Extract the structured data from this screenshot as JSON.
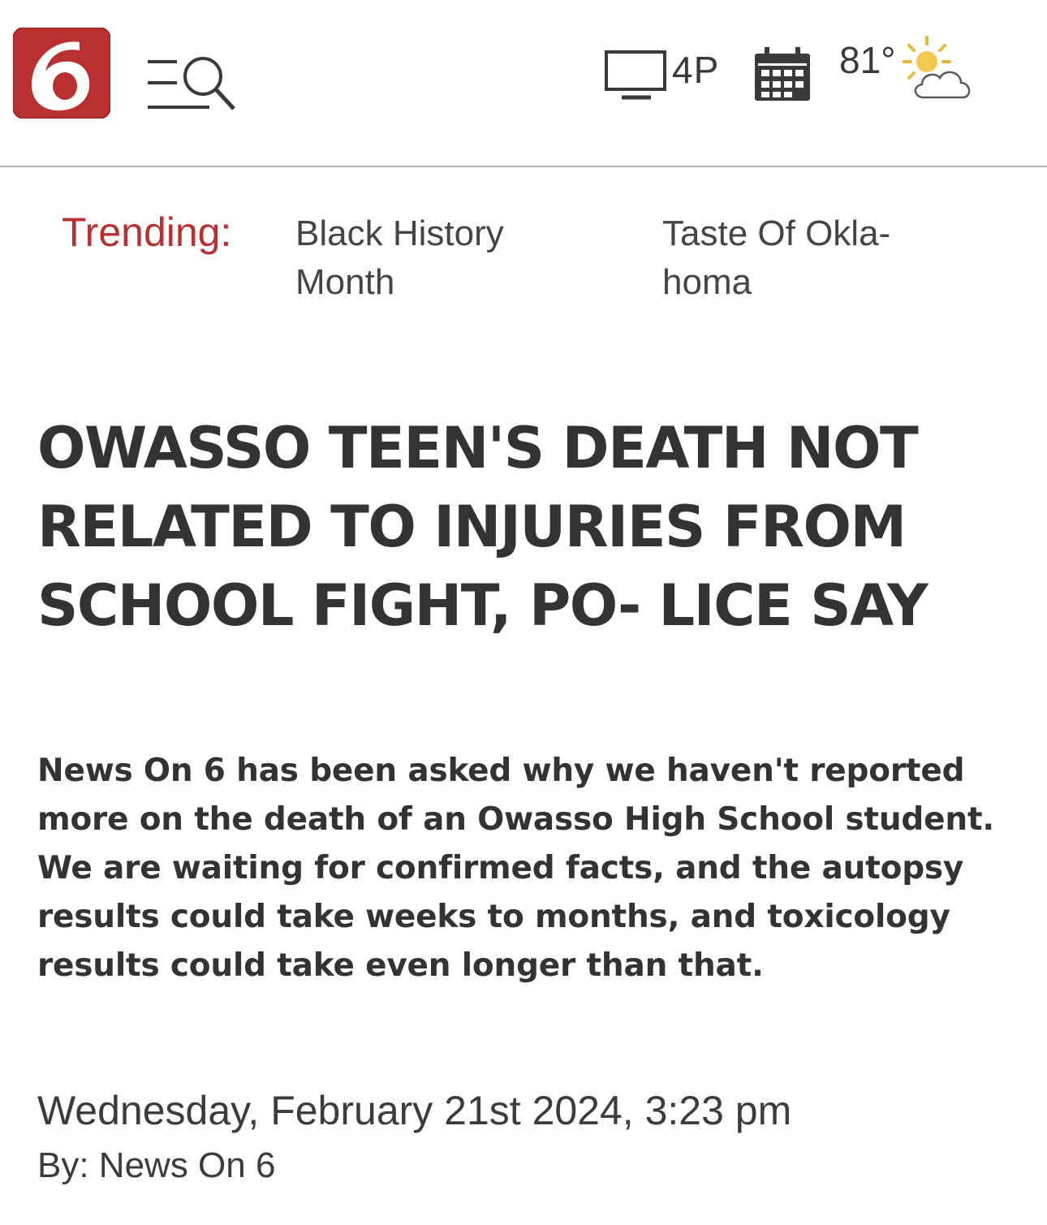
{
  "header": {
    "logo_icon": "news-on-6-logo-icon",
    "brand_color": "#b8302f",
    "menu_icon": "menu-search-icon",
    "live_icon": "tv-icon",
    "live_label": "4P",
    "calendar_icon": "calendar-icon",
    "weather": {
      "temperature": "81°",
      "icon": "partly-sunny-icon"
    }
  },
  "trending": {
    "label": "Trending:",
    "items": [
      {
        "label": "Black History Month"
      },
      {
        "label": "Taste Of Okla- homa"
      }
    ]
  },
  "article": {
    "headline": "OWASSO TEEN'S DEATH NOT RELATED TO INJURIES FROM SCHOOL FIGHT, PO- LICE SAY",
    "summary": "News On 6 has been asked why we haven't reported more on the death of an Owasso High School student. We are waiting for confirmed facts, and the autopsy results could take weeks to months, and toxicology results could take even longer than that.",
    "date": "Wednesday, February 21st 2024, 3:23 pm",
    "byline": "By: News On 6"
  }
}
